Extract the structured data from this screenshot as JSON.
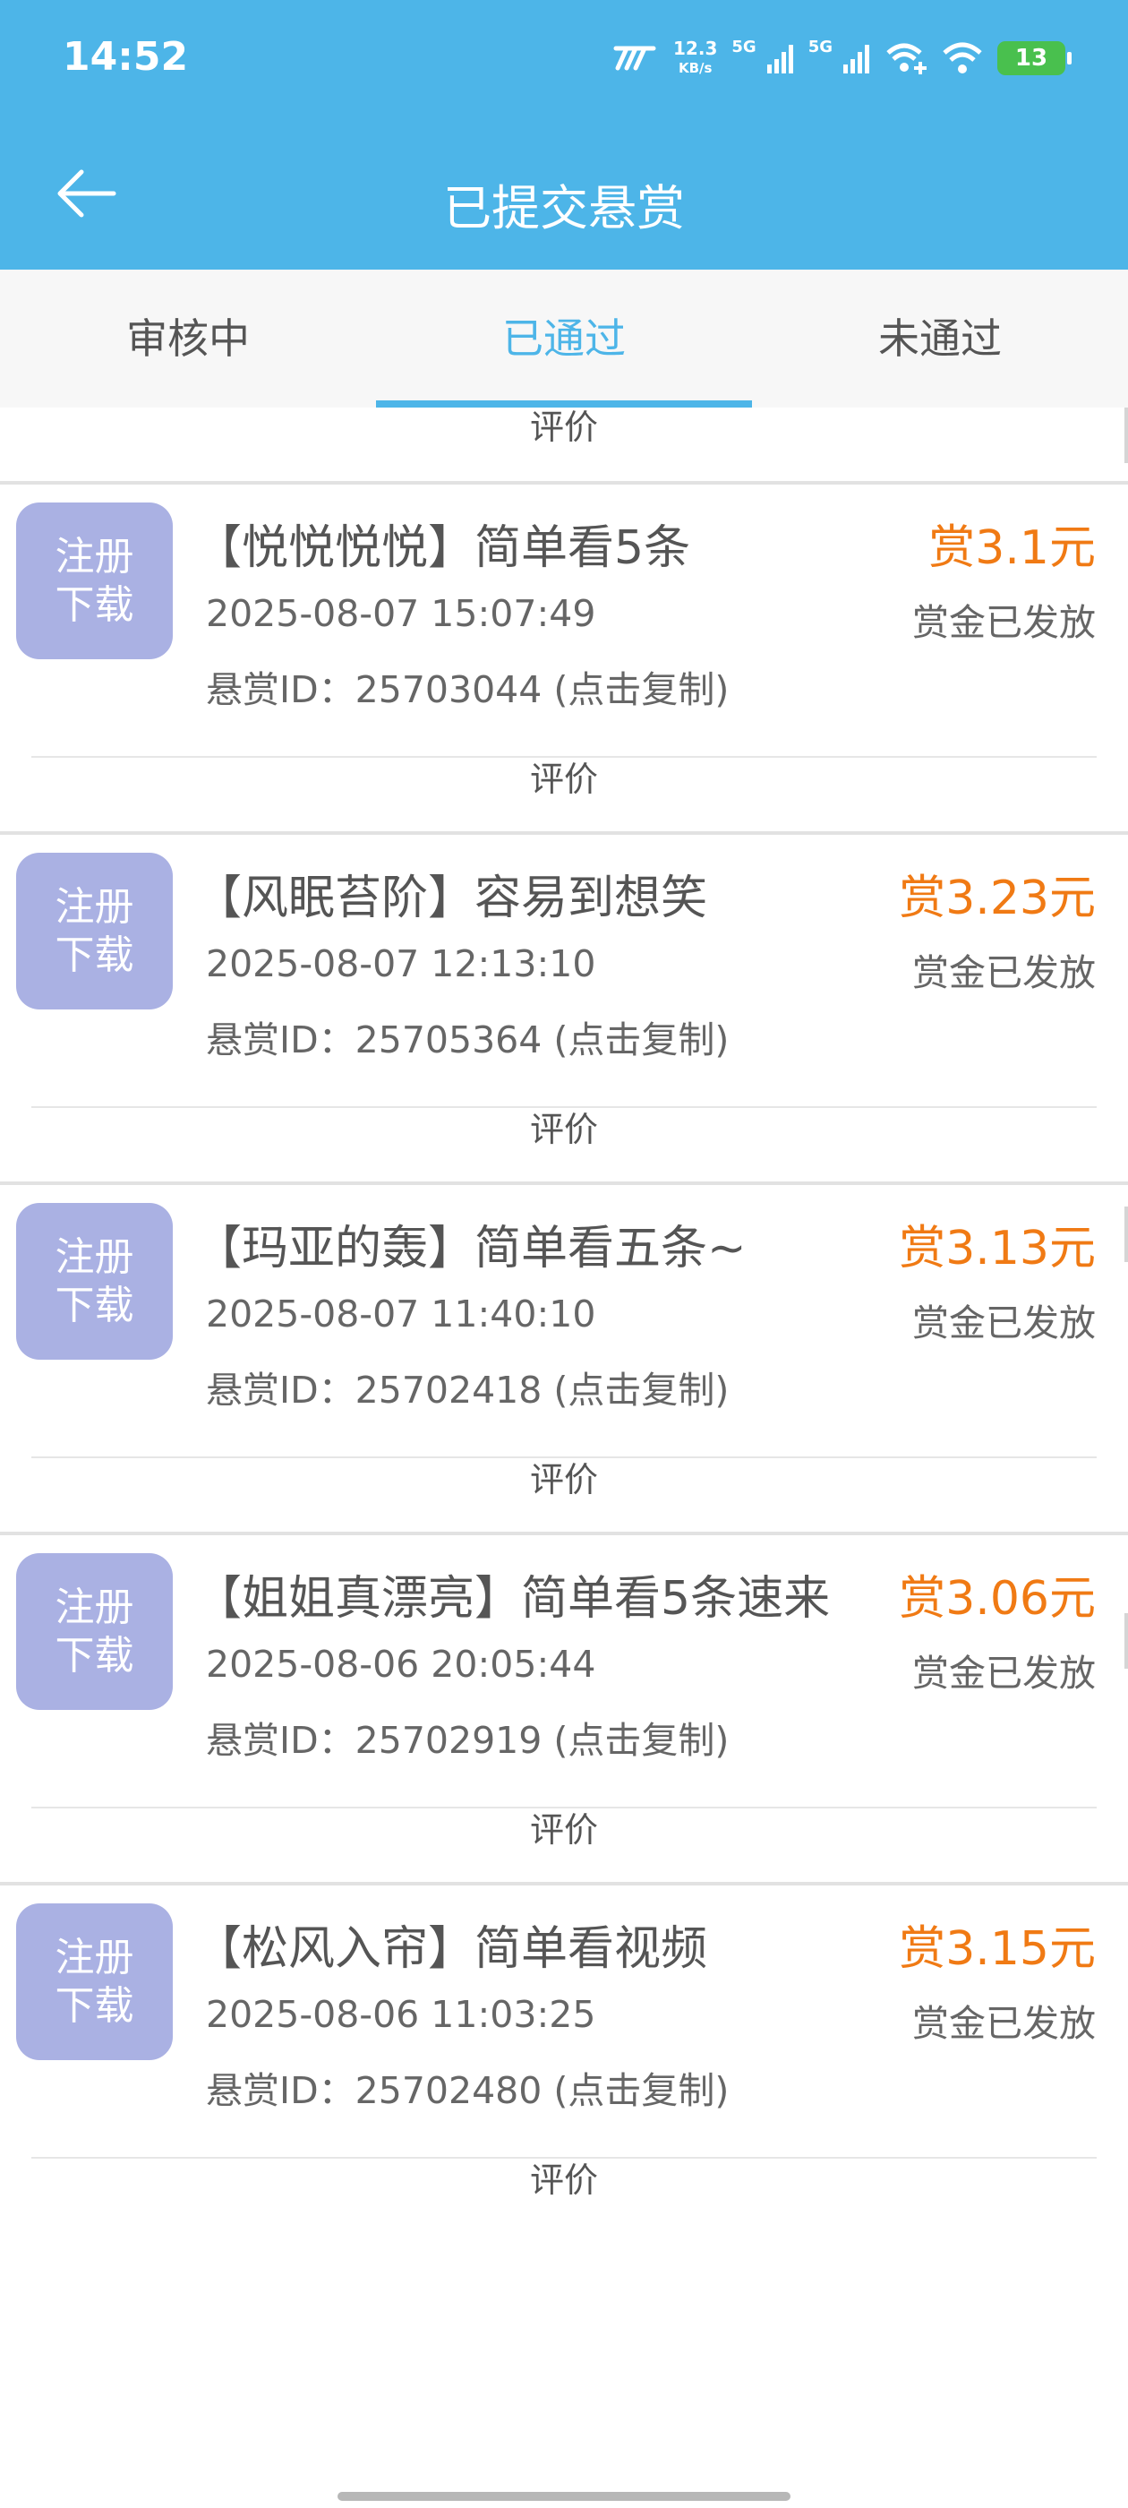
{
  "status_bar": {
    "time": "14:52",
    "speed_value": "12.3",
    "speed_unit": "KB/s",
    "signal_1": "5G",
    "signal_2": "5G",
    "battery": "13"
  },
  "title_bar": {
    "title": "已提交悬赏",
    "back_icon": "arrow-left-icon"
  },
  "tabs": [
    {
      "label": "审核中",
      "active": false
    },
    {
      "label": "已通过",
      "active": true
    },
    {
      "label": "未通过",
      "active": false
    }
  ],
  "evaluate_label": "评价",
  "items": [
    {
      "thumb_line1": "注册",
      "thumb_line2": "下载",
      "title": "【悦悦悦悦】简单看5条",
      "date": "2025-08-07 15:07:49",
      "bounty_id": "悬赏ID：25703044 (点击复制)",
      "reward": "赏3.1元",
      "status": "赏金已发放"
    },
    {
      "thumb_line1": "注册",
      "thumb_line2": "下载",
      "title": "【风眠苔阶】容易到想笑",
      "date": "2025-08-07 12:13:10",
      "bounty_id": "悬赏ID：25705364 (点击复制)",
      "reward": "赏3.23元",
      "status": "赏金已发放"
    },
    {
      "thumb_line1": "注册",
      "thumb_line2": "下载",
      "title": "【玛亚的轰】简单看五条~",
      "date": "2025-08-07 11:40:10",
      "bounty_id": "悬赏ID：25702418 (点击复制)",
      "reward": "赏3.13元",
      "status": "赏金已发放"
    },
    {
      "thumb_line1": "注册",
      "thumb_line2": "下载",
      "title": "【姐姐真漂亮】简单看5条速来",
      "date": "2025-08-06 20:05:44",
      "bounty_id": "悬赏ID：25702919 (点击复制)",
      "reward": "赏3.06元",
      "status": "赏金已发放"
    },
    {
      "thumb_line1": "注册",
      "thumb_line2": "下载",
      "title": "【松风入帘】简单看视频",
      "date": "2025-08-06 11:03:25",
      "bounty_id": "悬赏ID：25702480 (点击复制)",
      "reward": "赏3.15元",
      "status": "赏金已发放"
    }
  ],
  "colors": {
    "header": "#4db5e8",
    "reward": "#f07a14",
    "thumb": "#aab1e3",
    "active_tab": "#4db5e8"
  }
}
